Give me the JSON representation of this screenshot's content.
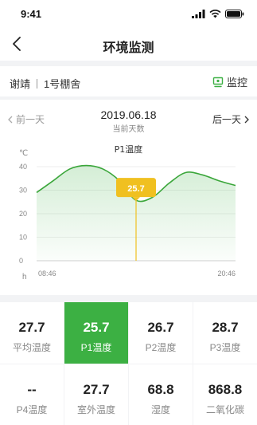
{
  "status_bar": {
    "time": "9:41"
  },
  "nav": {
    "title": "环境监测"
  },
  "info": {
    "user": "谢靖",
    "greenhouse": "1号棚舍",
    "monitor_label": "监控"
  },
  "date_nav": {
    "prev_label": "前一天",
    "next_label": "后一天",
    "date": "2019.06.18",
    "date_caption": "当前天数"
  },
  "colors": {
    "accent": "#3cb043",
    "tooltip": "#f0c020",
    "line": "#3aa63a"
  },
  "chart_data": {
    "type": "line",
    "title": "P1温度",
    "ylabel": "℃",
    "xlabel": "h",
    "ylim": [
      0,
      40
    ],
    "y_ticks": [
      0,
      10,
      20,
      30,
      40
    ],
    "x_tick_labels": [
      "08:46",
      "20:46"
    ],
    "x": [
      0,
      1,
      2,
      3,
      4,
      5,
      6,
      7,
      8,
      9,
      10,
      11,
      12
    ],
    "series": [
      {
        "values": [
          29,
          34,
          39,
          40.5,
          39,
          34,
          25.7,
          27,
          33,
          37.5,
          36.5,
          34,
          32
        ]
      }
    ],
    "tooltip": {
      "label": "25.7",
      "index": 6
    },
    "grid": true,
    "fill": "area"
  },
  "stats": [
    {
      "value": "27.7",
      "label": "平均温度",
      "active": false
    },
    {
      "value": "25.7",
      "label": "P1温度",
      "active": true
    },
    {
      "value": "26.7",
      "label": "P2温度",
      "active": false
    },
    {
      "value": "28.7",
      "label": "P3温度",
      "active": false
    },
    {
      "value": "--",
      "label": "P4温度",
      "active": false
    },
    {
      "value": "27.7",
      "label": "室外温度",
      "active": false
    },
    {
      "value": "68.8",
      "label": "湿度",
      "active": false
    },
    {
      "value": "868.8",
      "label": "二氧化碳",
      "active": false
    }
  ]
}
